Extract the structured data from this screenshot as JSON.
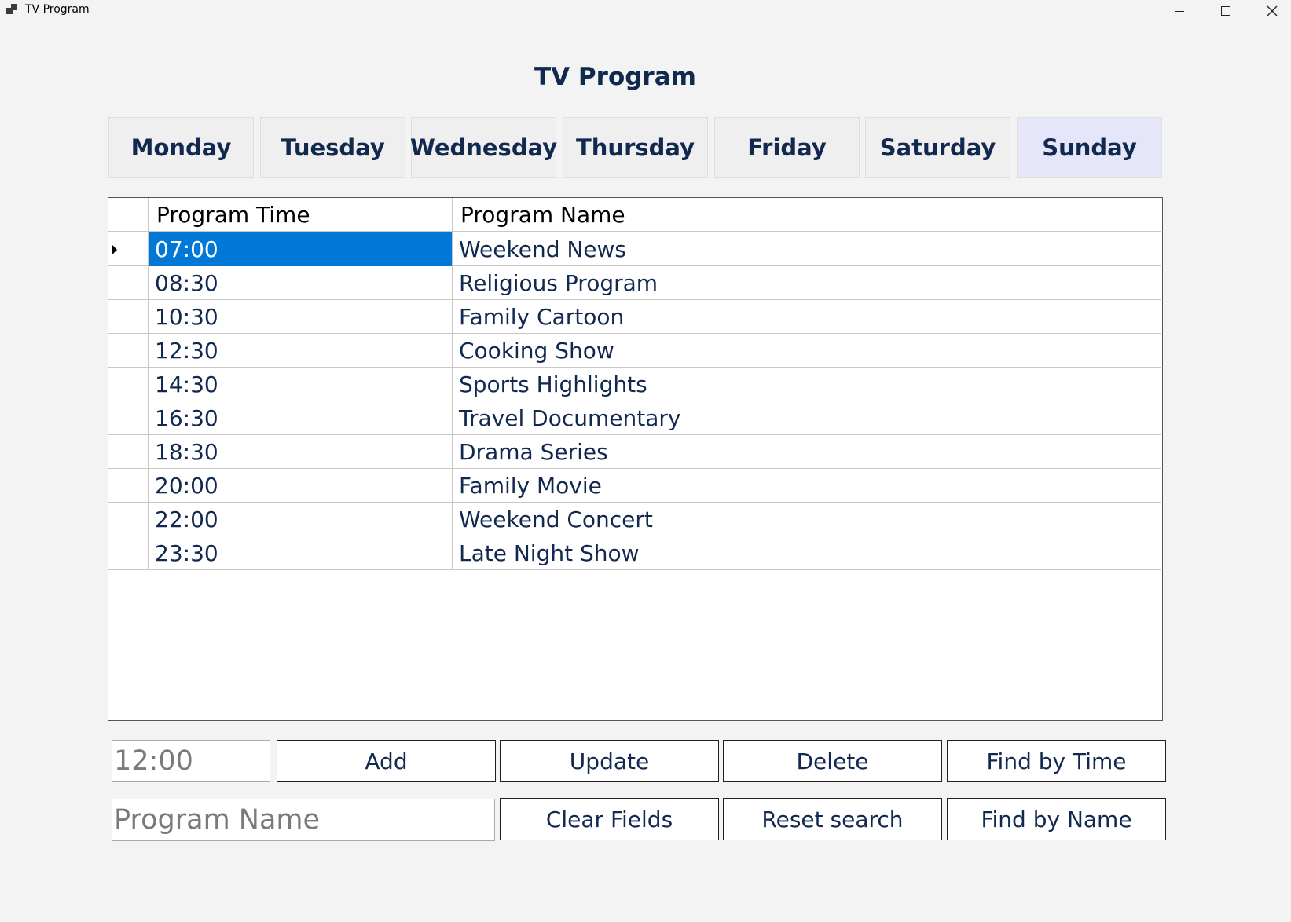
{
  "window": {
    "title": "TV Program",
    "controls": [
      "minimize",
      "maximize",
      "close"
    ]
  },
  "heading": "TV Program",
  "days": [
    {
      "label": "Monday",
      "active": false
    },
    {
      "label": "Tuesday",
      "active": false
    },
    {
      "label": "Wednesday",
      "active": false
    },
    {
      "label": "Thursday",
      "active": false
    },
    {
      "label": "Friday",
      "active": false
    },
    {
      "label": "Saturday",
      "active": false
    },
    {
      "label": "Sunday",
      "active": true
    }
  ],
  "grid": {
    "columns": [
      "Program Time",
      "Program Name"
    ],
    "selected_row": 0,
    "rows": [
      {
        "time": "07:00",
        "name": "Weekend News"
      },
      {
        "time": "08:30",
        "name": "Religious Program"
      },
      {
        "time": "10:30",
        "name": "Family Cartoon"
      },
      {
        "time": "12:30",
        "name": "Cooking Show"
      },
      {
        "time": "14:30",
        "name": "Sports Highlights"
      },
      {
        "time": "16:30",
        "name": "Travel Documentary"
      },
      {
        "time": "18:30",
        "name": "Drama Series"
      },
      {
        "time": "20:00",
        "name": "Family Movie"
      },
      {
        "time": "22:00",
        "name": "Weekend Concert"
      },
      {
        "time": "23:30",
        "name": "Late Night Show"
      }
    ]
  },
  "inputs": {
    "time_placeholder": "12:00",
    "name_placeholder": "Program Name"
  },
  "buttons": {
    "add": "Add",
    "update": "Update",
    "delete": "Delete",
    "find_time": "Find by Time",
    "clear": "Clear Fields",
    "reset": "Reset search",
    "find_name": "Find by Name"
  },
  "colors": {
    "text": "#12294f",
    "selection": "#0078d7",
    "active_tab": "#e6e6fa"
  }
}
